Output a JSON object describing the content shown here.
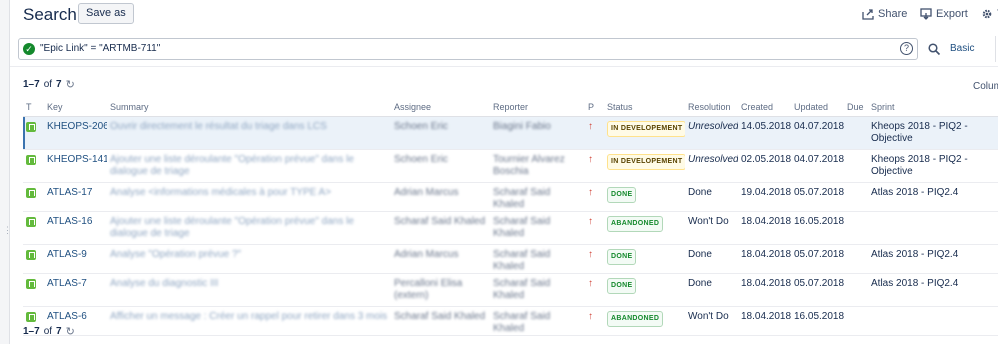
{
  "header": {
    "title": "Search",
    "save_as": "Save as",
    "share": "Share",
    "export": "Export",
    "tools": "T"
  },
  "query": {
    "text": "\"Epic Link\" = \"ARTMB-711\"",
    "basic": "Basic"
  },
  "pagination": {
    "range": "1–7",
    "of": "of",
    "total": "7"
  },
  "columns_label": "Colum",
  "table": {
    "headers": [
      "T",
      "Key",
      "Summary",
      "Assignee",
      "Reporter",
      "P",
      "Status",
      "Resolution",
      "Created",
      "Updated",
      "Due",
      "Sprint"
    ],
    "rows": [
      {
        "key": "KHEOPS-206",
        "summary": "Ouvrir directement le résultat du triage dans LCS",
        "assignee": "Schoen Eric",
        "reporter": "Biagini Fabio",
        "status": "IN DEVELOPEMENT",
        "resolution": "Unresolved",
        "created": "14.05.2018",
        "updated": "04.07.2018",
        "due": "",
        "sprint": "Kheops 2018 - PIQ2 - Objective"
      },
      {
        "key": "KHEOPS-141",
        "summary": "Ajouter une liste déroulante \"Opération prévue\" dans le dialogue de triage",
        "assignee": "Schoen Eric",
        "reporter": "Tournier Alvarez Boschia",
        "status": "IN DEVELOPEMENT",
        "resolution": "Unresolved",
        "created": "02.05.2018",
        "updated": "04.07.2018",
        "due": "",
        "sprint": "Kheops 2018 - PIQ2 - Objective"
      },
      {
        "key": "ATLAS-17",
        "summary": "Analyse <informations médicales à pour TYPE A>",
        "assignee": "Adrian Marcus",
        "reporter": "Scharaf Said Khaled",
        "status": "DONE",
        "resolution": "Done",
        "created": "19.04.2018",
        "updated": "05.07.2018",
        "due": "",
        "sprint": "Atlas 2018 - PIQ2.4"
      },
      {
        "key": "ATLAS-16",
        "summary": "Ajouter une liste déroulante \"Opération prévue\" dans le dialogue de triage",
        "assignee": "Scharaf Said Khaled",
        "reporter": "Scharaf Said Khaled",
        "status": "ABANDONED",
        "resolution": "Won't Do",
        "created": "18.04.2018",
        "updated": "16.05.2018",
        "due": "",
        "sprint": ""
      },
      {
        "key": "ATLAS-9",
        "summary": "Analyse \"Opération prévue ?\"",
        "assignee": "Adrian Marcus",
        "reporter": "Scharaf Said Khaled",
        "status": "DONE",
        "resolution": "Done",
        "created": "18.04.2018",
        "updated": "05.07.2018",
        "due": "",
        "sprint": "Atlas 2018 - PIQ2.4"
      },
      {
        "key": "ATLAS-7",
        "summary": "Analyse du diagnostic III",
        "assignee": "Percalloni Elisa (extern)",
        "reporter": "Scharaf Said Khaled",
        "status": "DONE",
        "resolution": "Done",
        "created": "18.04.2018",
        "updated": "05.07.2018",
        "due": "",
        "sprint": "Atlas 2018 - PIQ2.4"
      },
      {
        "key": "ATLAS-6",
        "summary": "Afficher un message : Créer un rappel pour retirer dans 3 mois",
        "assignee": "Scharaf Said Khaled",
        "reporter": "Scharaf Said Khaled",
        "status": "ABANDONED",
        "resolution": "Won't Do",
        "created": "18.04.2018",
        "updated": "16.05.2018",
        "due": "",
        "sprint": ""
      }
    ]
  }
}
